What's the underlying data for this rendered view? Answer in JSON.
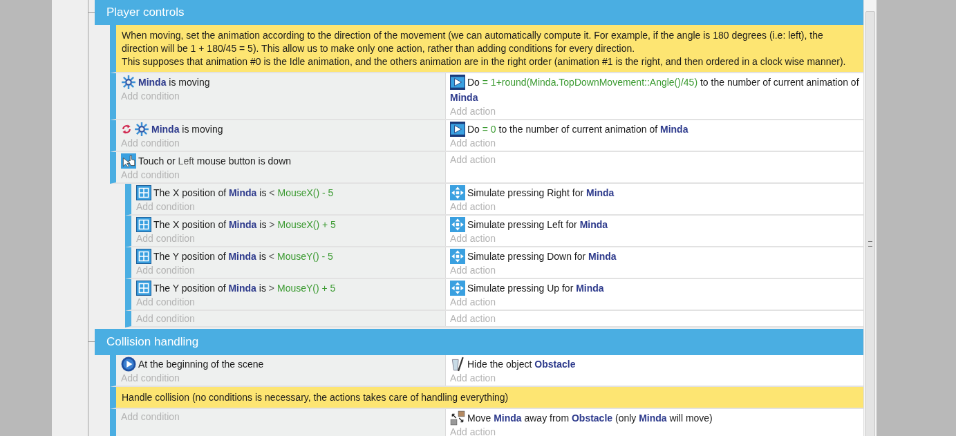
{
  "groups": [
    {
      "title": "Player controls",
      "items": [
        {
          "kind": "comment",
          "text": "When moving, set the animation according to the direction of the movement (we can automatically compute it. For example, if the angle is 180 degrees (i.e: left), the direction will be 1 + 180/45 = 5). This allow us to make only one action, rather than adding conditions for every direction.\nThis supposes that animation #0 is the Idle animation, and the others animation are in the right order (animation #1 is the right, and then ordered in a clock wise manner)."
        },
        {
          "kind": "event",
          "add_condition": "Add condition",
          "add_action": "Add action",
          "conditions": [
            {
              "kind": "movement",
              "inverted": false,
              "parts": [
                {
                  "kind": "object",
                  "text": "Minda"
                },
                {
                  "kind": "text",
                  "text": " is moving"
                }
              ]
            }
          ],
          "actions": [
            {
              "kind": "animation",
              "parts": [
                {
                  "kind": "text",
                  "text": "Do "
                },
                {
                  "kind": "expr",
                  "text": "= 1+round(Minda.TopDownMovement::Angle()/45)"
                },
                {
                  "kind": "text",
                  "text": " to the number of current animation of "
                },
                {
                  "kind": "object",
                  "text": "Minda"
                }
              ]
            }
          ]
        },
        {
          "kind": "event",
          "add_condition": "Add condition",
          "add_action": "Add action",
          "conditions": [
            {
              "kind": "movement",
              "inverted": true,
              "parts": [
                {
                  "kind": "object",
                  "text": "Minda"
                },
                {
                  "kind": "text",
                  "text": " is moving"
                }
              ]
            }
          ],
          "actions": [
            {
              "kind": "animation",
              "parts": [
                {
                  "kind": "text",
                  "text": "Do "
                },
                {
                  "kind": "expr",
                  "text": "= 0"
                },
                {
                  "kind": "text",
                  "text": " to the number of current animation of "
                },
                {
                  "kind": "object",
                  "text": "Minda"
                }
              ]
            }
          ]
        },
        {
          "kind": "event",
          "add_condition": "Add condition",
          "add_action": "Add action",
          "conditions": [
            {
              "kind": "mouse",
              "inverted": false,
              "parts": [
                {
                  "kind": "text",
                  "text": "Touch or "
                },
                {
                  "kind": "param",
                  "text": "Left"
                },
                {
                  "kind": "text",
                  "text": " mouse button is down"
                }
              ]
            }
          ],
          "children": [
            {
              "kind": "event",
              "add_condition": "Add condition",
              "add_action": "Add action",
              "conditions": [
                {
                  "kind": "position",
                  "inverted": false,
                  "parts": [
                    {
                      "kind": "text",
                      "text": "The X position of "
                    },
                    {
                      "kind": "object",
                      "text": "Minda"
                    },
                    {
                      "kind": "text",
                      "text": " is "
                    },
                    {
                      "kind": "param",
                      "text": "<"
                    },
                    {
                      "kind": "expr",
                      "text": "MouseX() - 5"
                    }
                  ]
                }
              ],
              "actions": [
                {
                  "kind": "keyboard",
                  "parts": [
                    {
                      "kind": "text",
                      "text": "Simulate pressing Right for "
                    },
                    {
                      "kind": "object",
                      "text": "Minda"
                    }
                  ]
                }
              ]
            },
            {
              "kind": "event",
              "add_condition": "Add condition",
              "add_action": "Add action",
              "conditions": [
                {
                  "kind": "position",
                  "inverted": false,
                  "parts": [
                    {
                      "kind": "text",
                      "text": "The X position of "
                    },
                    {
                      "kind": "object",
                      "text": "Minda"
                    },
                    {
                      "kind": "text",
                      "text": " is "
                    },
                    {
                      "kind": "param",
                      "text": ">"
                    },
                    {
                      "kind": "expr",
                      "text": "MouseX() + 5"
                    }
                  ]
                }
              ],
              "actions": [
                {
                  "kind": "keyboard",
                  "parts": [
                    {
                      "kind": "text",
                      "text": "Simulate pressing Left for "
                    },
                    {
                      "kind": "object",
                      "text": "Minda"
                    }
                  ]
                }
              ]
            },
            {
              "kind": "event",
              "add_condition": "Add condition",
              "add_action": "Add action",
              "conditions": [
                {
                  "kind": "position",
                  "inverted": false,
                  "parts": [
                    {
                      "kind": "text",
                      "text": "The Y position of "
                    },
                    {
                      "kind": "object",
                      "text": "Minda"
                    },
                    {
                      "kind": "text",
                      "text": " is "
                    },
                    {
                      "kind": "param",
                      "text": "<"
                    },
                    {
                      "kind": "expr",
                      "text": "MouseY() - 5"
                    }
                  ]
                }
              ],
              "actions": [
                {
                  "kind": "keyboard",
                  "parts": [
                    {
                      "kind": "text",
                      "text": "Simulate pressing Down for "
                    },
                    {
                      "kind": "object",
                      "text": "Minda"
                    }
                  ]
                }
              ]
            },
            {
              "kind": "event",
              "add_condition": "Add condition",
              "add_action": "Add action",
              "conditions": [
                {
                  "kind": "position",
                  "inverted": false,
                  "parts": [
                    {
                      "kind": "text",
                      "text": "The Y position of "
                    },
                    {
                      "kind": "object",
                      "text": "Minda"
                    },
                    {
                      "kind": "text",
                      "text": " is "
                    },
                    {
                      "kind": "param",
                      "text": ">"
                    },
                    {
                      "kind": "expr",
                      "text": "MouseY() + 5"
                    }
                  ]
                }
              ],
              "actions": [
                {
                  "kind": "keyboard",
                  "parts": [
                    {
                      "kind": "text",
                      "text": "Simulate pressing Up for "
                    },
                    {
                      "kind": "object",
                      "text": "Minda"
                    }
                  ]
                }
              ]
            },
            {
              "kind": "event",
              "add_condition": "Add condition",
              "add_action": "Add action"
            }
          ]
        }
      ]
    },
    {
      "title": "Collision handling",
      "items": [
        {
          "kind": "event",
          "add_condition": "Add condition",
          "add_action": "Add action",
          "conditions": [
            {
              "kind": "scene-start",
              "inverted": false,
              "parts": [
                {
                  "kind": "text",
                  "text": "At the beginning of the scene"
                }
              ]
            }
          ],
          "actions": [
            {
              "kind": "hide",
              "parts": [
                {
                  "kind": "text",
                  "text": "Hide the object "
                },
                {
                  "kind": "object",
                  "text": "Obstacle"
                }
              ]
            }
          ]
        },
        {
          "kind": "comment",
          "text": "Handle collision (no conditions is necessary, the actions takes care of handling everything)"
        },
        {
          "kind": "event",
          "add_condition": "Add condition",
          "add_action": "Add action",
          "actions": [
            {
              "kind": "separate",
              "parts": [
                {
                  "kind": "text",
                  "text": "Move "
                },
                {
                  "kind": "object",
                  "text": "Minda"
                },
                {
                  "kind": "text",
                  "text": " away from "
                },
                {
                  "kind": "object",
                  "text": "Obstacle"
                },
                {
                  "kind": "text",
                  "text": " (only "
                },
                {
                  "kind": "object",
                  "text": "Minda"
                },
                {
                  "kind": "text",
                  "text": " will move)"
                }
              ]
            }
          ]
        }
      ]
    }
  ]
}
